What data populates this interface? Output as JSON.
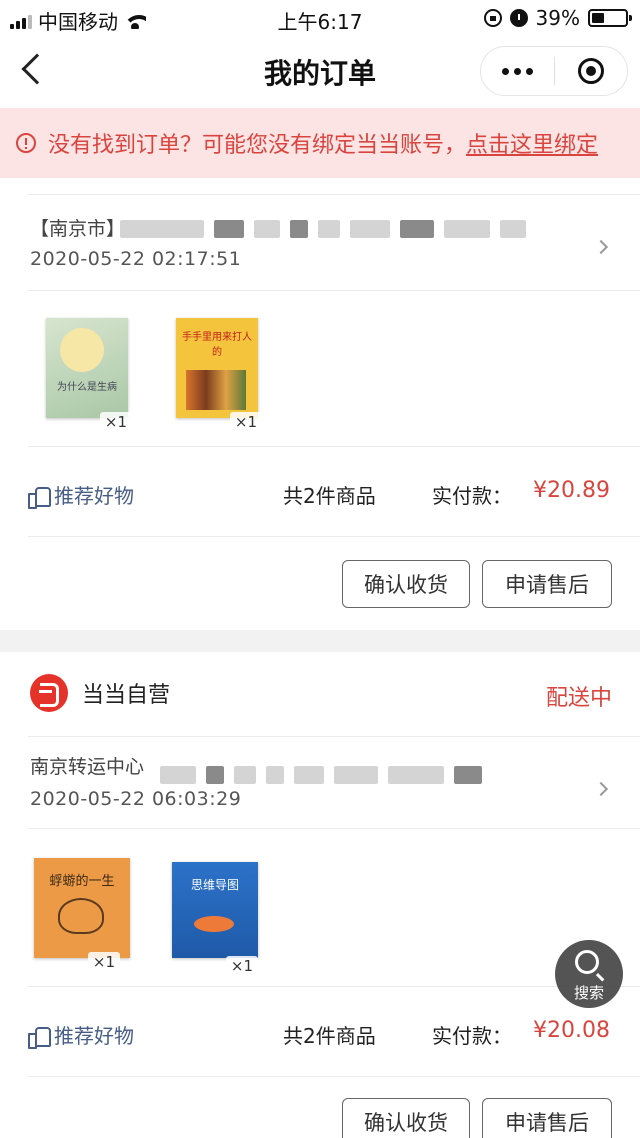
{
  "status_bar": {
    "carrier": "中国移动",
    "time": "上午6:17",
    "battery": "39%",
    "battery_level": 0.39
  },
  "nav": {
    "title": "我的订单"
  },
  "notice": {
    "text": "没有找到订单？可能您没有绑定当当账号，",
    "link": "点击这里绑定"
  },
  "orders": [
    {
      "address_prefix": "【南京市】",
      "time": "2020-05-22 02:17:51",
      "items": [
        {
          "cover_title": "为什么是生病",
          "qty": "×1"
        },
        {
          "cover_title": "手手里用来打人的",
          "qty": "×1"
        }
      ],
      "recommend": "推荐好物",
      "count": "共2件商品",
      "paid_label": "实付款：",
      "price": "¥20.89",
      "buttons": [
        "确认收货",
        "申请售后"
      ]
    },
    {
      "shop": "当当自营",
      "status": "配送中",
      "address_prefix": "南京转运中心",
      "time": "2020-05-22 06:03:29",
      "items": [
        {
          "cover_title": "蜉蝣的一生",
          "qty": "×1"
        },
        {
          "cover_title": "思维导图",
          "qty": "×1"
        }
      ],
      "recommend": "推荐好物",
      "count": "共2件商品",
      "paid_label": "实付款：",
      "price": "¥20.08",
      "buttons": [
        "确认收货",
        "申请售后"
      ]
    }
  ],
  "fab": {
    "label": "搜索"
  }
}
